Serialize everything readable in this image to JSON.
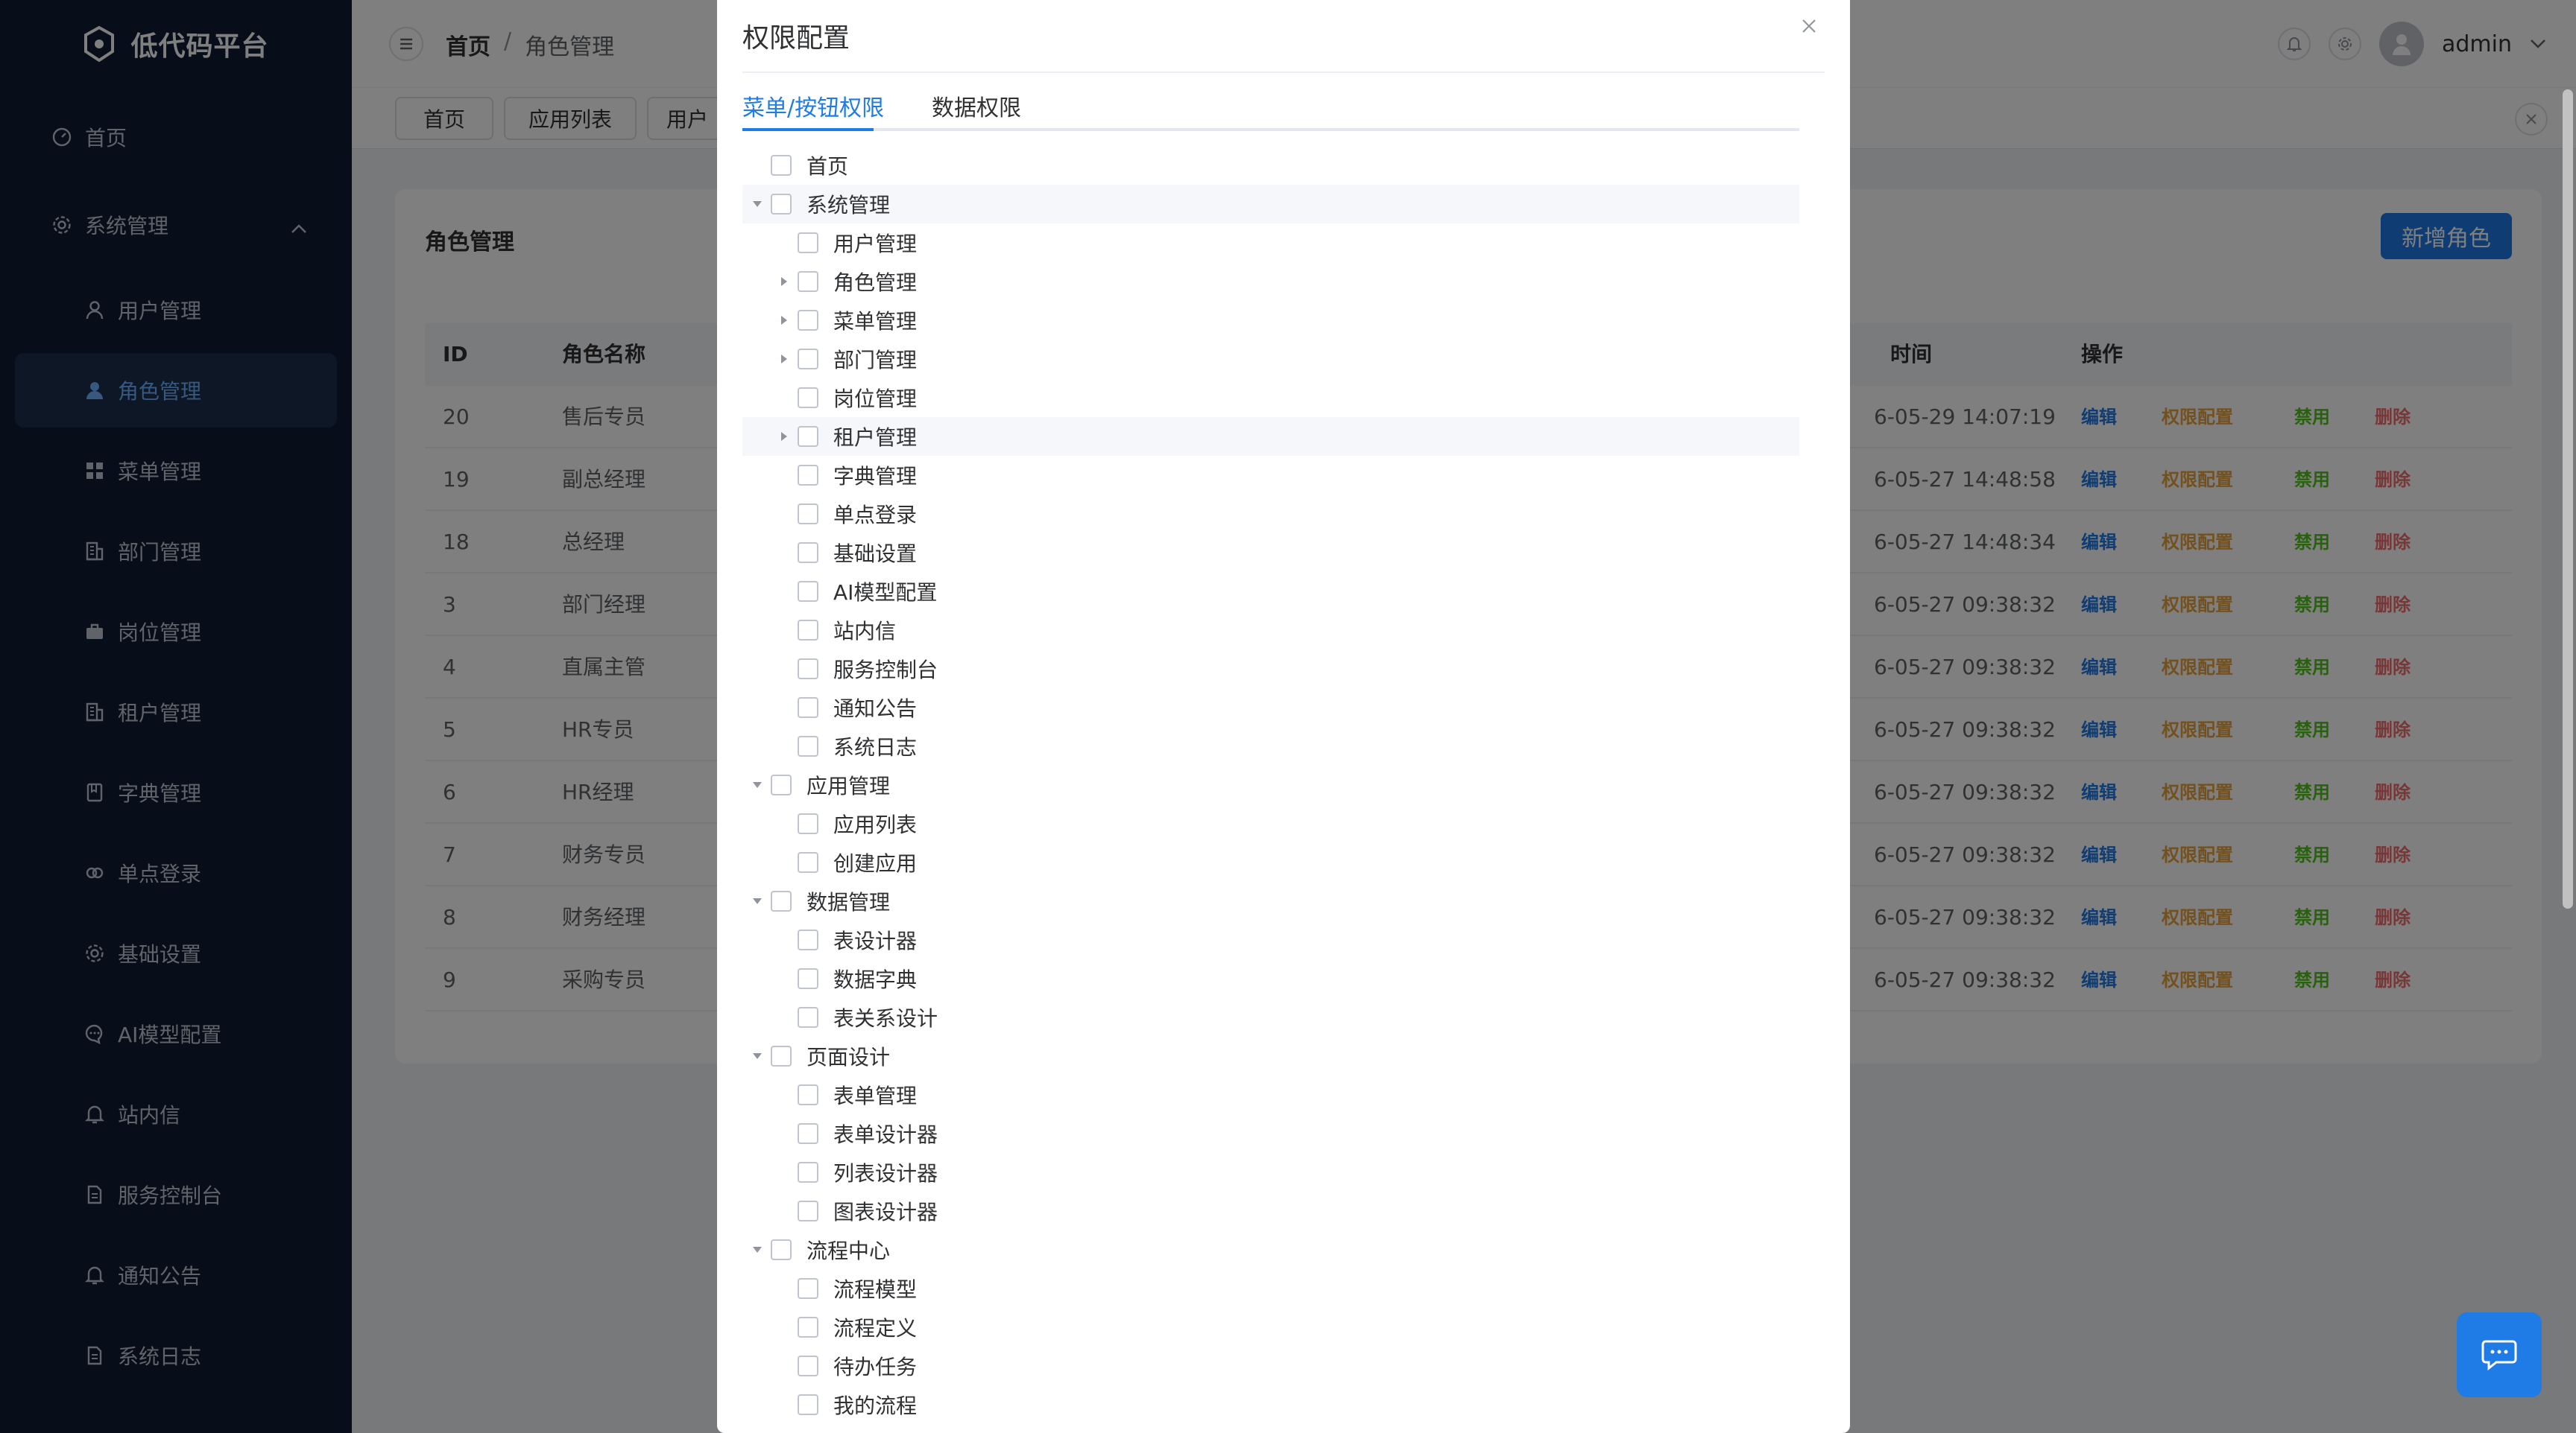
{
  "app": {
    "title": "低代码平台"
  },
  "sidebar": {
    "items": [
      {
        "label": "首页",
        "icon": "dashboard-icon"
      },
      {
        "label": "系统管理",
        "icon": "gear-icon"
      },
      {
        "label": "用户管理",
        "icon": "user-icon"
      },
      {
        "label": "角色管理",
        "icon": "user-filled-icon"
      },
      {
        "label": "菜单管理",
        "icon": "grid-icon"
      },
      {
        "label": "部门管理",
        "icon": "building-icon"
      },
      {
        "label": "岗位管理",
        "icon": "briefcase-icon"
      },
      {
        "label": "租户管理",
        "icon": "building-icon"
      },
      {
        "label": "字典管理",
        "icon": "book-icon"
      },
      {
        "label": "单点登录",
        "icon": "link-icon"
      },
      {
        "label": "基础设置",
        "icon": "gear-icon"
      },
      {
        "label": "AI模型配置",
        "icon": "chat-icon"
      },
      {
        "label": "站内信",
        "icon": "bell-icon"
      },
      {
        "label": "服务控制台",
        "icon": "document-icon"
      },
      {
        "label": "通知公告",
        "icon": "bell-icon"
      },
      {
        "label": "系统日志",
        "icon": "document-icon"
      }
    ]
  },
  "header": {
    "breadcrumb": {
      "home": "首页",
      "separator": "/",
      "current": "角色管理"
    },
    "user": "admin"
  },
  "tabs": [
    {
      "label": "首页"
    },
    {
      "label": "应用列表"
    },
    {
      "label": "用户"
    }
  ],
  "card": {
    "title": "角色管理",
    "add_button": "新增角色",
    "columns": {
      "id": "ID",
      "name": "角色名称",
      "time": "时间",
      "ops": "操作"
    },
    "actions": {
      "edit": "编辑",
      "perm": "权限配置",
      "disable": "禁用",
      "delete": "删除"
    },
    "rows": [
      {
        "id": "20",
        "name": "售后专员",
        "time": "6-05-29 14:07:19"
      },
      {
        "id": "19",
        "name": "副总经理",
        "time": "6-05-27 14:48:58"
      },
      {
        "id": "18",
        "name": "总经理",
        "time": "6-05-27 14:48:34"
      },
      {
        "id": "3",
        "name": "部门经理",
        "time": "6-05-27 09:38:32"
      },
      {
        "id": "4",
        "name": "直属主管",
        "time": "6-05-27 09:38:32"
      },
      {
        "id": "5",
        "name": "HR专员",
        "time": "6-05-27 09:38:32"
      },
      {
        "id": "6",
        "name": "HR经理",
        "time": "6-05-27 09:38:32"
      },
      {
        "id": "7",
        "name": "财务专员",
        "time": "6-05-27 09:38:32"
      },
      {
        "id": "8",
        "name": "财务经理",
        "time": "6-05-27 09:38:32"
      },
      {
        "id": "9",
        "name": "采购专员",
        "time": "6-05-27 09:38:32"
      }
    ]
  },
  "modal": {
    "title": "权限配置",
    "tabs": [
      {
        "label": "菜单/按钮权限"
      },
      {
        "label": "数据权限"
      }
    ],
    "tree": [
      {
        "label": "首页",
        "level": 0,
        "arrow": "none"
      },
      {
        "label": "系统管理",
        "level": 0,
        "arrow": "down"
      },
      {
        "label": "用户管理",
        "level": 1,
        "arrow": "none"
      },
      {
        "label": "角色管理",
        "level": 1,
        "arrow": "right"
      },
      {
        "label": "菜单管理",
        "level": 1,
        "arrow": "right"
      },
      {
        "label": "部门管理",
        "level": 1,
        "arrow": "right"
      },
      {
        "label": "岗位管理",
        "level": 1,
        "arrow": "none"
      },
      {
        "label": "租户管理",
        "level": 1,
        "arrow": "right"
      },
      {
        "label": "字典管理",
        "level": 1,
        "arrow": "none"
      },
      {
        "label": "单点登录",
        "level": 1,
        "arrow": "none"
      },
      {
        "label": "基础设置",
        "level": 1,
        "arrow": "none"
      },
      {
        "label": "AI模型配置",
        "level": 1,
        "arrow": "none"
      },
      {
        "label": "站内信",
        "level": 1,
        "arrow": "none"
      },
      {
        "label": "服务控制台",
        "level": 1,
        "arrow": "none"
      },
      {
        "label": "通知公告",
        "level": 1,
        "arrow": "none"
      },
      {
        "label": "系统日志",
        "level": 1,
        "arrow": "none"
      },
      {
        "label": "应用管理",
        "level": 0,
        "arrow": "down"
      },
      {
        "label": "应用列表",
        "level": 1,
        "arrow": "none"
      },
      {
        "label": "创建应用",
        "level": 1,
        "arrow": "none"
      },
      {
        "label": "数据管理",
        "level": 0,
        "arrow": "down"
      },
      {
        "label": "表设计器",
        "level": 1,
        "arrow": "none"
      },
      {
        "label": "数据字典",
        "level": 1,
        "arrow": "none"
      },
      {
        "label": "表关系设计",
        "level": 1,
        "arrow": "none"
      },
      {
        "label": "页面设计",
        "level": 0,
        "arrow": "down"
      },
      {
        "label": "表单管理",
        "level": 1,
        "arrow": "none"
      },
      {
        "label": "表单设计器",
        "level": 1,
        "arrow": "none"
      },
      {
        "label": "列表设计器",
        "level": 1,
        "arrow": "none"
      },
      {
        "label": "图表设计器",
        "level": 1,
        "arrow": "none"
      },
      {
        "label": "流程中心",
        "level": 0,
        "arrow": "down"
      },
      {
        "label": "流程模型",
        "level": 1,
        "arrow": "none"
      },
      {
        "label": "流程定义",
        "level": 1,
        "arrow": "none"
      },
      {
        "label": "待办任务",
        "level": 1,
        "arrow": "none"
      },
      {
        "label": "我的流程",
        "level": 1,
        "arrow": "none"
      }
    ]
  },
  "colors": {
    "primary": "#1f7be6",
    "sidebar_bg": "#0e1c33",
    "warning": "#e6a23c",
    "success": "#52c41a",
    "danger": "#f56c6c"
  }
}
